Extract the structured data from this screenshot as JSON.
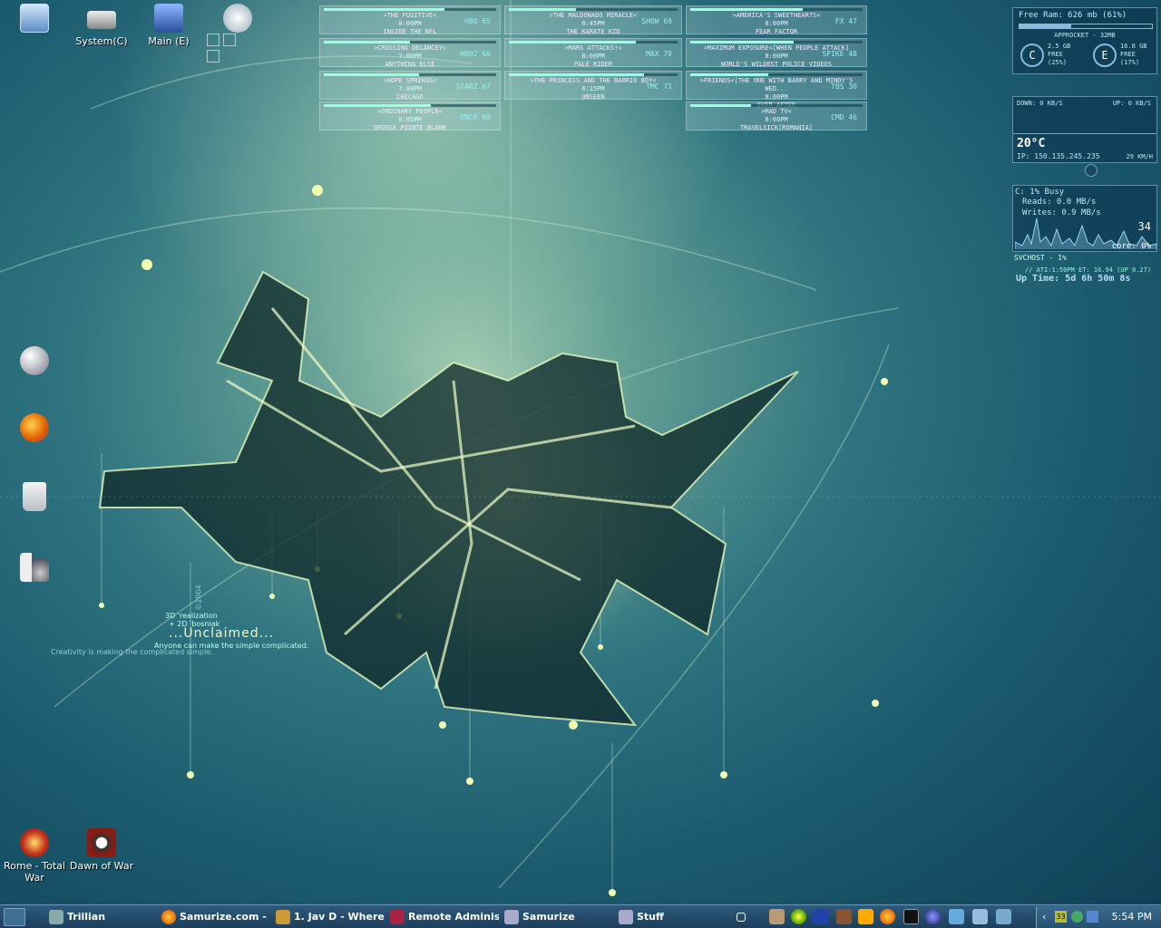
{
  "desktop_icons": {
    "my_computer": "",
    "system_c": "System(C)",
    "main_e": "Main (E)",
    "rome": "Rome - Total War",
    "dawn": "Dawn of War"
  },
  "wallpaper": {
    "title": "...Unclaimed...",
    "tagline": "Anyone can make the simple complicated.",
    "tagline2": "Creativity is making the complicated simple.",
    "credit1": "3D 'realization",
    "credit2": "+ 2D 'bosniak",
    "year": "©2004"
  },
  "tv_guide": [
    {
      "title": ">THE FUGITIVE<",
      "time": "8:00PM",
      "show": "INSIDE THE NFL",
      "channel": "HBO  65"
    },
    {
      "title": ">THE MALDONADO MIRACLE<",
      "time": "6:45PM",
      "show": "THE KARATE KID",
      "channel": "SHOW 69"
    },
    {
      "title": ">AMERICA'S SWEETHEARTS<",
      "time": "8:00PM",
      "show": "FEAR FACTOR",
      "channel": "FX  47"
    },
    {
      "title": ">CROSSING DELANCEY<",
      "time": "7:00PM",
      "show": "ANYTHING ELSE",
      "channel": "HBO2  66"
    },
    {
      "title": ">MARS ATTACKS!<",
      "time": "8:00PM",
      "show": "PALE RIDER",
      "channel": "MAX  70"
    },
    {
      "title": ">MAXIMUM EXPOSURE<[WHEN PEOPLE ATTACK]",
      "time": "8:00PM",
      "show": "WORLD'S WILDEST POLICE VIDEOS",
      "channel": "SPIKE 48"
    },
    {
      "title": ">HOPE SPRINGS<",
      "time": "7:00PM",
      "show": "CHICAGO",
      "channel": "STARZ 67"
    },
    {
      "title": ">THE PRINCESS AND THE BARRIO BOY<",
      "time": "6:15PM",
      "show": "UNSEEN",
      "channel": "TMC  71"
    },
    {
      "title": ">FRIENDS<[THE ONE WITH BARRY AND MINDY'S WED...",
      "time": "8:00PM",
      "show": "EVER AFTER",
      "channel": "TBS  30"
    },
    {
      "title": ">ORDINARY PEOPLE<",
      "time": "8:05PM",
      "show": "GROSSE POINTE BLANK",
      "channel": "ENCR 68"
    },
    {
      "title": ">MAD TV<",
      "time": "8:00PM",
      "show": "TRAVELSICK[ROMANIA]",
      "channel": "CMD  46"
    }
  ],
  "monitor": {
    "ram": "Free Ram: 626 mb (61%)",
    "top_proc": "APPROCKET - 32MB",
    "c_free": "2.5 GB",
    "c_free_lbl": "FREE",
    "c_pct": "(25%)",
    "e_free": "16.8 GB",
    "e_free_lbl": "FREE",
    "e_pct": "(17%)",
    "drive_c": "C",
    "drive_e": "E",
    "down": "DOWN: 0 KB/S",
    "up": "UP: 0 KB/S",
    "temp": "20°C",
    "ip": "IP: 150.135.245.235",
    "wind": "29 KM/H",
    "cpu_busy": "C: 1% Busy",
    "reads": "Reads: 0.0 MB/s",
    "writes": "Writes: 0.9 MB/s",
    "cpu_num": "34",
    "core": "core: 0%",
    "svchost": "SVCHOST - 1%",
    "ati": "// ATI:1:50PM ET: 16.94 (UP 0.27)",
    "uptime": "Up Time: 5d 6h 50m 8s"
  },
  "taskbar": {
    "items": [
      "Trillian",
      "Samurize.com - ...",
      "1. Jav D - Where...",
      "Remote Administ...",
      "Samurize",
      "Stuff"
    ],
    "tray_count": "33",
    "clock": "5:54 PM"
  }
}
